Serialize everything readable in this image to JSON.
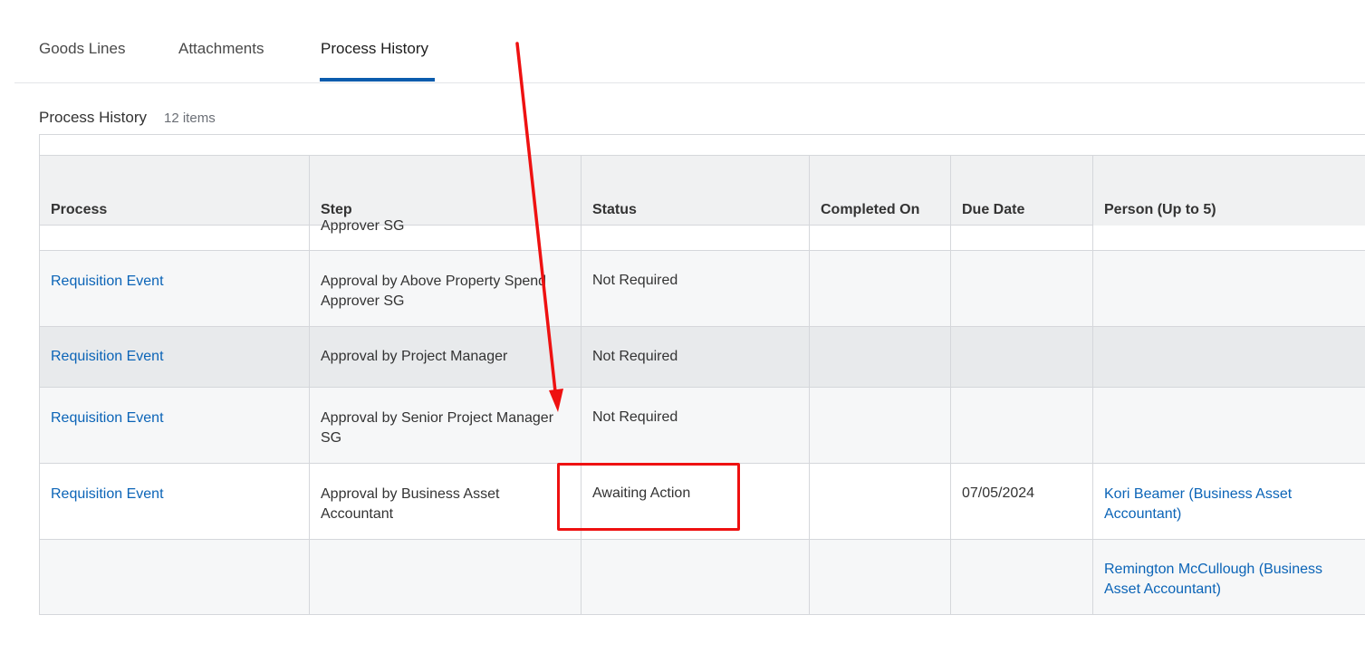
{
  "tabs": [
    {
      "label": "Goods Lines",
      "active": false
    },
    {
      "label": "Attachments",
      "active": false
    },
    {
      "label": "Process History",
      "active": true
    }
  ],
  "section": {
    "title": "Process History",
    "count": "12 items"
  },
  "table": {
    "columns": [
      "Process",
      "Step",
      "Status",
      "Completed On",
      "Due Date",
      "Person (Up to 5)"
    ],
    "partial_row_step": "Approver SG",
    "rows": [
      {
        "process": "Requisition Event",
        "step": [
          "Approval by Above Property Spend",
          "Approver SG"
        ],
        "status": "Not Required",
        "completed_on": "",
        "due_date": "",
        "person": []
      },
      {
        "process": "Requisition Event",
        "step": [
          "Approval by Project Manager"
        ],
        "status": "Not Required",
        "completed_on": "",
        "due_date": "",
        "person": []
      },
      {
        "process": "Requisition Event",
        "step": [
          "Approval by Senior Project Manager",
          "SG"
        ],
        "status": "Not Required",
        "completed_on": "",
        "due_date": "",
        "person": []
      },
      {
        "process": "Requisition Event",
        "step": [
          "Approval by Business Asset",
          "Accountant"
        ],
        "status": "Awaiting Action",
        "completed_on": "",
        "due_date": "07/05/2024",
        "person": [
          "Kori Beamer (Business Asset",
          "Accountant)"
        ]
      },
      {
        "process": "",
        "step": [],
        "status": "",
        "completed_on": "",
        "due_date": "",
        "person": [
          "Remington McCullough (Business",
          "Asset Accountant)"
        ]
      }
    ]
  },
  "colors": {
    "accent": "#0b5cad",
    "link": "#0b64b7",
    "annotation": "#ee1111",
    "header_bg": "#f0f1f2",
    "row_alt": "#f6f7f8",
    "row_hover": "#e8eaec"
  }
}
